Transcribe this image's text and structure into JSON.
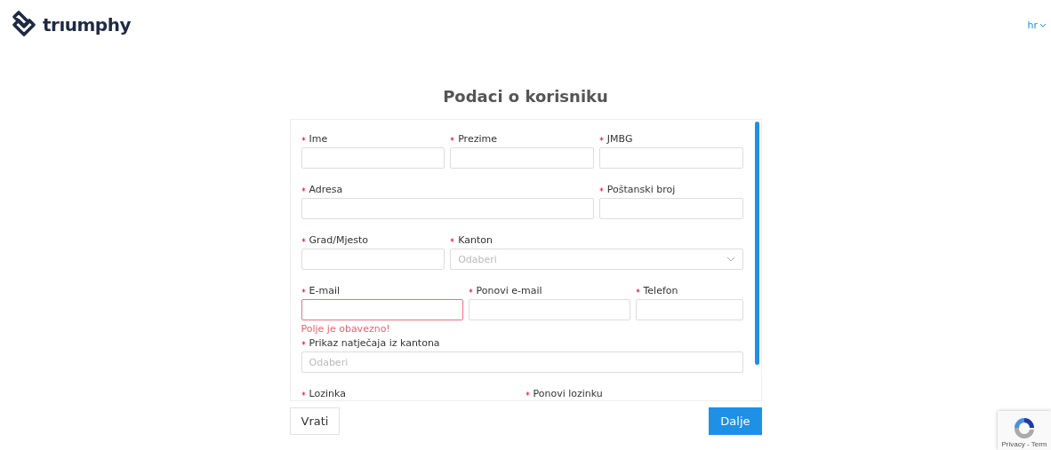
{
  "header": {
    "brand": "trıumphy",
    "language": "hr"
  },
  "form": {
    "title": "Podaci o korisniku",
    "rows": [
      [
        {
          "label": "Ime",
          "required": true,
          "kind": "input",
          "invalid": false
        },
        {
          "label": "Prezime",
          "required": true,
          "kind": "input",
          "invalid": false
        },
        {
          "label": "JMBG",
          "required": true,
          "kind": "input",
          "invalid": false
        }
      ],
      [
        {
          "label": "Adresa",
          "required": true,
          "kind": "input",
          "invalid": false,
          "colspan": 2
        },
        {
          "label": "Poštanski broj",
          "required": true,
          "kind": "input",
          "invalid": false
        }
      ],
      [
        {
          "label": "Grad/Mjesto",
          "required": true,
          "kind": "input",
          "invalid": false
        },
        {
          "label": "Kanton",
          "required": true,
          "kind": "select",
          "placeholder": "Odaberi",
          "invalid": false,
          "colspan": 2
        }
      ],
      [
        {
          "label": "E-mail",
          "required": true,
          "kind": "input",
          "invalid": true,
          "error": "Polje je obavezno!"
        },
        {
          "label": "Ponovi e-mail",
          "required": true,
          "kind": "input",
          "invalid": false
        },
        {
          "label": "Telefon",
          "required": true,
          "kind": "input",
          "invalid": false
        }
      ],
      [
        {
          "label": "Prikaz natječaja iz kantona",
          "required": true,
          "kind": "select-plain",
          "placeholder": "Odaberi",
          "invalid": false
        }
      ],
      [
        {
          "label": "Lozinka",
          "required": true
        },
        {
          "label": "Ponovi lozinku",
          "required": true
        }
      ]
    ],
    "buttons": {
      "back": "Vrati",
      "next": "Dalje"
    }
  },
  "recaptcha": {
    "links": "Privacy - Term"
  }
}
